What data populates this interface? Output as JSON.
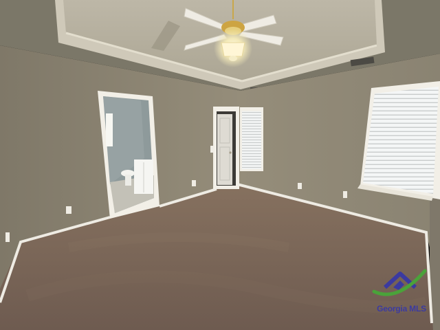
{
  "watermark": {
    "brand": "Georgia MLS",
    "colors": {
      "purple": "#3b3aa0",
      "green": "#4aa33a"
    }
  },
  "palette": {
    "wall_left": "#8e8674",
    "wall_right": "#948c79",
    "ceiling": "#7b7768",
    "tray": "#b8b2a2",
    "carpet": "#7a6659",
    "trim": "#f2efe7",
    "window_light": "#f4f6f6"
  }
}
